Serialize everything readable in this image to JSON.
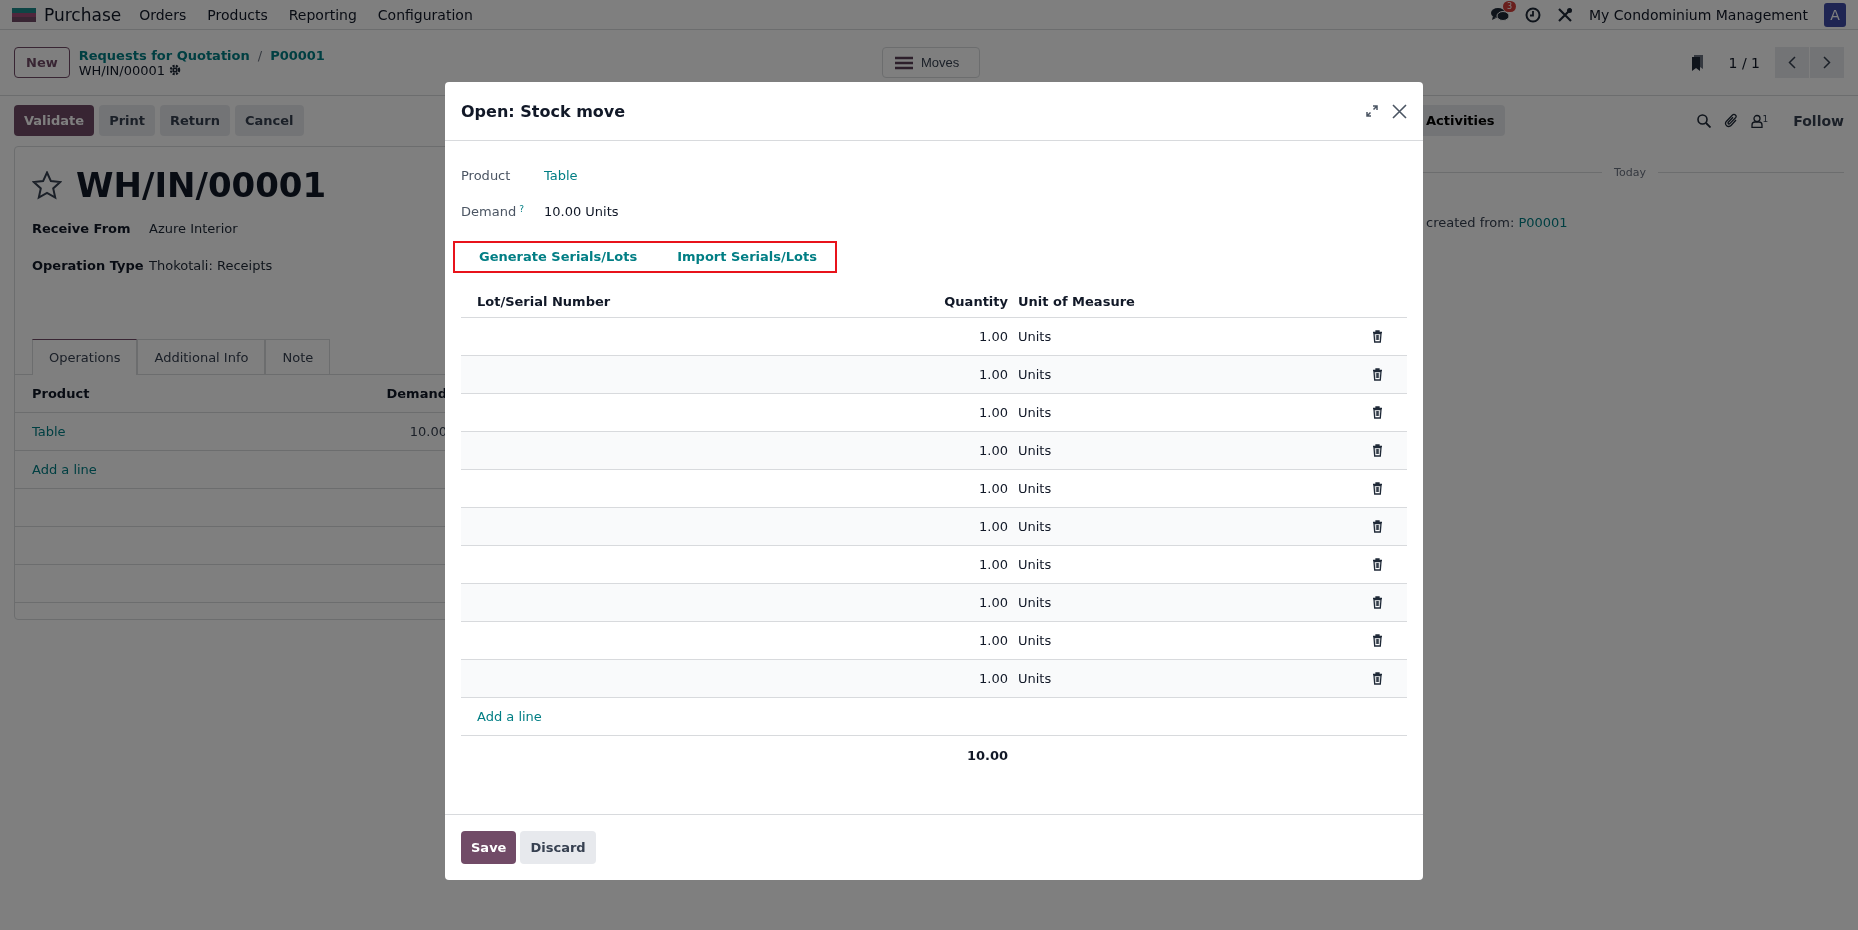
{
  "navbar": {
    "app_name": "Purchase",
    "menus": [
      "Orders",
      "Products",
      "Reporting",
      "Configuration"
    ],
    "messages_badge": "3",
    "company": "My Condominium Management",
    "avatar": "A"
  },
  "control_panel": {
    "new_button": "New",
    "breadcrumbs": [
      "Requests for Quotation",
      "P00001"
    ],
    "breadcrumb_separator": "/",
    "record": "WH/IN/00001",
    "moves_button": "Moves",
    "pager": "1 / 1"
  },
  "actions": [
    {
      "label": "Validate",
      "kind": "primary"
    },
    {
      "label": "Print",
      "kind": "secondary"
    },
    {
      "label": "Return",
      "kind": "secondary"
    },
    {
      "label": "Cancel",
      "kind": "secondary"
    }
  ],
  "form": {
    "title": "WH/IN/00001",
    "starred": false,
    "fields": [
      {
        "label": "Receive From",
        "value": "Azure Interior"
      },
      {
        "label": "Operation Type",
        "value": "Thokotali: Receipts"
      }
    ],
    "tabs": [
      {
        "label": "Operations",
        "selected": true
      },
      {
        "label": "Additional Info",
        "selected": false
      },
      {
        "label": "Note",
        "selected": false
      }
    ],
    "columns": [
      "Product",
      "Demand"
    ],
    "rows": [
      {
        "product": "Table",
        "demand": "10.00"
      }
    ],
    "add_line": "Add a line"
  },
  "chatter": {
    "activities": "Activities",
    "followers": "1",
    "follow": "Follow",
    "date_separator": "Today",
    "message": "created from:",
    "message_link": "P00001"
  },
  "dialog": {
    "title": "Open: Stock move",
    "fields": [
      {
        "label": "Product",
        "value": "Table",
        "kind": "link"
      },
      {
        "label": "Demand",
        "help": "?",
        "value": "10.00",
        "unit": "Units",
        "kind": "quantity"
      }
    ],
    "actions": [
      "Generate Serials/Lots",
      "Import Serials/Lots"
    ],
    "actions_highlighted": true,
    "columns": [
      "Lot/Serial Number",
      "Quantity",
      "Unit of Measure"
    ],
    "rows": [
      {
        "quantity": "1.00",
        "unit": "Units"
      },
      {
        "quantity": "1.00",
        "unit": "Units"
      },
      {
        "quantity": "1.00",
        "unit": "Units"
      },
      {
        "quantity": "1.00",
        "unit": "Units"
      },
      {
        "quantity": "1.00",
        "unit": "Units"
      },
      {
        "quantity": "1.00",
        "unit": "Units"
      },
      {
        "quantity": "1.00",
        "unit": "Units"
      },
      {
        "quantity": "1.00",
        "unit": "Units"
      },
      {
        "quantity": "1.00",
        "unit": "Units"
      },
      {
        "quantity": "1.00",
        "unit": "Units"
      }
    ],
    "add_line": "Add a line",
    "total": "10.00",
    "buttons": [
      {
        "label": "Save",
        "kind": "primary"
      },
      {
        "label": "Discard",
        "kind": "secondary"
      }
    ]
  }
}
